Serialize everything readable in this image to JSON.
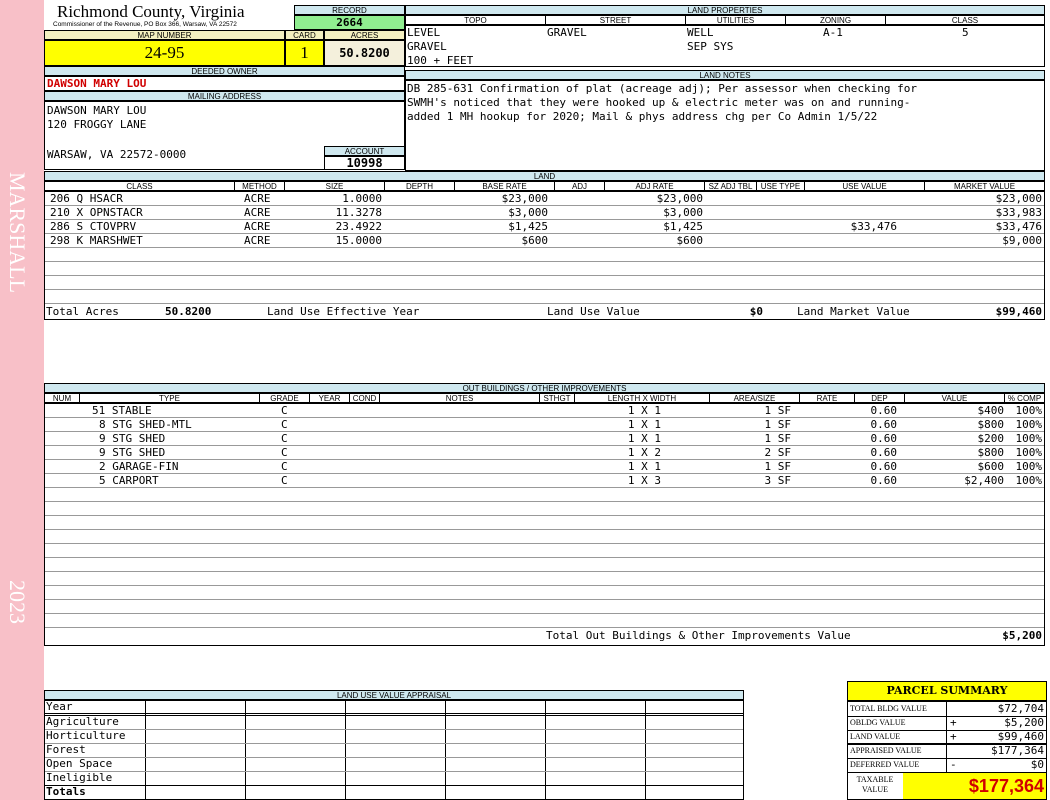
{
  "sidebar": {
    "district": "MARSHALL",
    "year": "2023"
  },
  "header": {
    "county": "Richmond County, Virginia",
    "address": "Commissioner of the Revenue, PO Box 366, Warsaw, VA 22572",
    "record_label": "RECORD",
    "record": "2664",
    "map_number_label": "MAP NUMBER",
    "map_number": "24-95",
    "card_label": "CARD",
    "card": "1",
    "acres_label": "ACRES",
    "acres": "50.8200"
  },
  "owner": {
    "deeded_label": "DEEDED OWNER",
    "deeded_owner": "DAWSON MARY LOU",
    "mailing_label": "MAILING ADDRESS",
    "mailing_lines": [
      "DAWSON MARY LOU",
      "120 FROGGY LANE",
      "",
      "WARSAW, VA 22572-0000"
    ],
    "account_label": "ACCOUNT",
    "account": "10998"
  },
  "land_properties": {
    "title": "LAND PROPERTIES",
    "headers": [
      "TOPO",
      "STREET",
      "UTILITIES",
      "ZONING",
      "CLASS"
    ],
    "topo": [
      "LEVEL",
      "GRAVEL",
      "100 + FEET"
    ],
    "street": "GRAVEL",
    "utilities": [
      "WELL",
      "SEP SYS"
    ],
    "zoning": "A-1",
    "class": "5"
  },
  "land_notes": {
    "title": "LAND NOTES",
    "lines": [
      "DB 285-631 Confirmation of plat (acreage adj); Per assessor when checking for",
      "SWMH's noticed that they were hooked up & electric meter was on and running-",
      "added 1 MH hookup for 2020; Mail & phys address chg per Co Admin 1/5/22"
    ]
  },
  "land": {
    "title": "LAND",
    "headers": [
      "CLASS",
      "METHOD",
      "SIZE",
      "DEPTH",
      "BASE RATE",
      "ADJ",
      "ADJ RATE",
      "SZ ADJ TBL",
      "USE TYPE",
      "USE VALUE",
      "MARKET VALUE"
    ],
    "rows": [
      {
        "class": "206 Q HSACR",
        "method": "ACRE",
        "size": "1.0000",
        "base_rate": "$23,000",
        "adj_rate": "$23,000",
        "use_value": "",
        "market_value": "$23,000"
      },
      {
        "class": "210 X OPNSTACR",
        "method": "ACRE",
        "size": "11.3278",
        "base_rate": "$3,000",
        "adj_rate": "$3,000",
        "use_value": "",
        "market_value": "$33,983"
      },
      {
        "class": "286 S CTOVPRV",
        "method": "ACRE",
        "size": "23.4922",
        "base_rate": "$1,425",
        "adj_rate": "$1,425",
        "use_value": "$33,476",
        "market_value": "$33,476"
      },
      {
        "class": "298 K MARSHWET",
        "method": "ACRE",
        "size": "15.0000",
        "base_rate": "$600",
        "adj_rate": "$600",
        "use_value": "",
        "market_value": "$9,000"
      }
    ],
    "total_acres_label": "Total Acres",
    "total_acres": "50.8200",
    "effective_year_label": "Land Use Effective Year",
    "use_value_label": "Land Use Value",
    "use_value": "$0",
    "market_value_label": "Land Market Value",
    "market_value": "$99,460"
  },
  "outbuildings": {
    "title": "OUT BUILDINGS / OTHER IMPROVEMENTS",
    "headers": [
      "NUM",
      "TYPE",
      "GRADE",
      "YEAR",
      "COND",
      "NOTES",
      "STHGT",
      "LENGTH X WIDTH",
      "AREA/SIZE",
      "RATE",
      "DEP",
      "VALUE",
      "% COMP"
    ],
    "rows": [
      {
        "type": "51 STABLE",
        "grade": "C",
        "lxw": "1 X 1",
        "area": "1 SF",
        "dep": "0.60",
        "value": "$400",
        "comp": "100%"
      },
      {
        "type": "8 STG SHED-MTL",
        "grade": "C",
        "lxw": "1 X 1",
        "area": "1 SF",
        "dep": "0.60",
        "value": "$800",
        "comp": "100%"
      },
      {
        "type": "9 STG SHED",
        "grade": "C",
        "lxw": "1 X 1",
        "area": "1 SF",
        "dep": "0.60",
        "value": "$200",
        "comp": "100%"
      },
      {
        "type": "9 STG SHED",
        "grade": "C",
        "lxw": "1 X 2",
        "area": "2 SF",
        "dep": "0.60",
        "value": "$800",
        "comp": "100%"
      },
      {
        "type": "2 GARAGE-FIN",
        "grade": "C",
        "lxw": "1 X 1",
        "area": "1 SF",
        "dep": "0.60",
        "value": "$600",
        "comp": "100%"
      },
      {
        "type": "5 CARPORT",
        "grade": "C",
        "lxw": "1 X 3",
        "area": "3 SF",
        "dep": "0.60",
        "value": "$2,400",
        "comp": "100%"
      }
    ],
    "total_label": "Total Out Buildings & Other Improvements Value",
    "total": "$5,200"
  },
  "land_use_appraisal": {
    "title": "LAND USE VALUE APPRAISAL",
    "rows": [
      "Year",
      "Agriculture",
      "Horticulture",
      "Forest",
      "Open Space",
      "Ineligible",
      "Totals"
    ]
  },
  "summary": {
    "title": "PARCEL SUMMARY",
    "rows": [
      {
        "label": "TOTAL BLDG VALUE",
        "sign": "",
        "value": "$72,704"
      },
      {
        "label": "OBLDG VALUE",
        "sign": "+",
        "value": "$5,200"
      },
      {
        "label": "LAND VALUE",
        "sign": "+",
        "value": "$99,460"
      },
      {
        "label": "APPRAISED VALUE",
        "sign": "",
        "value": "$177,364"
      },
      {
        "label": "DEFERRED VALUE",
        "sign": "-",
        "value": "$0"
      }
    ],
    "taxable_label": "TAXABLE VALUE",
    "taxable": "$177,364"
  }
}
